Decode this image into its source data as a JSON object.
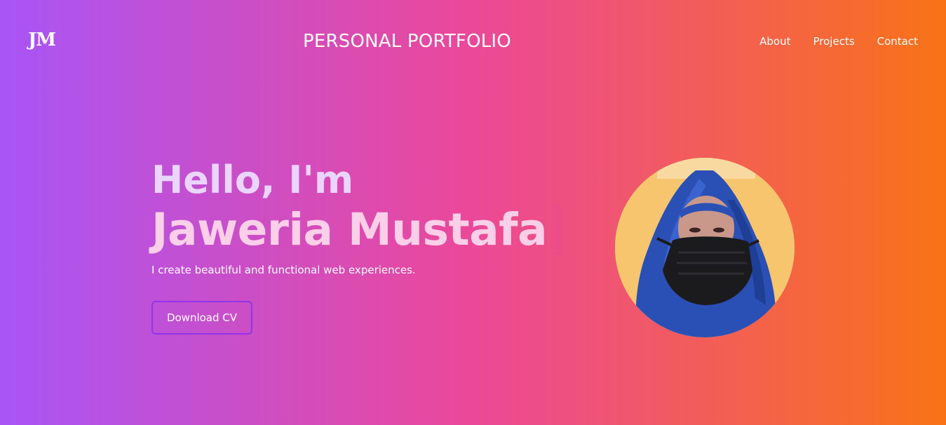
{
  "header": {
    "logo": "JM",
    "title": "PERSONAL PORTFOLIO",
    "nav": [
      {
        "label": "About"
      },
      {
        "label": "Projects"
      },
      {
        "label": "Contact"
      }
    ]
  },
  "hero": {
    "greeting": "Hello, I'm",
    "name": "Jaweria Mustafa",
    "tagline": "I create beautiful and functional web experiences.",
    "cv_button": "Download CV"
  },
  "colors": {
    "gradient_start": "#a855f7",
    "gradient_mid": "#ec4899",
    "gradient_end": "#f97316",
    "button_border": "#9333ea",
    "avatar_bg": "#f6c56e"
  }
}
